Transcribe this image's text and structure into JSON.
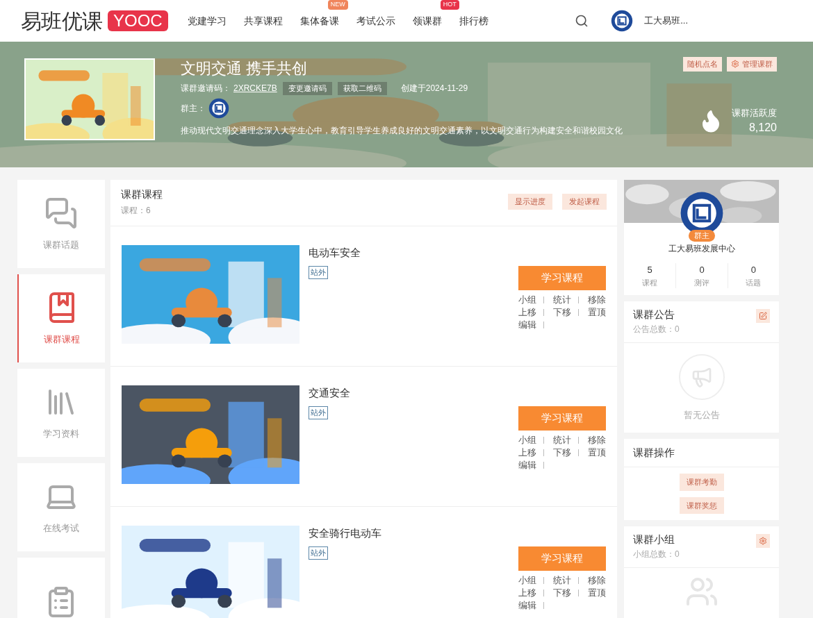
{
  "header": {
    "logo_text": "易班优课",
    "logo_badge": "YOOC",
    "nav": [
      {
        "label": "党建学习"
      },
      {
        "label": "共享课程"
      },
      {
        "label": "集体备课",
        "badge": "NEW"
      },
      {
        "label": "考试公示"
      },
      {
        "label": "领课群",
        "badge": "HOT"
      },
      {
        "label": "排行榜"
      }
    ],
    "user": "工大易班..."
  },
  "banner": {
    "title": "文明交通 携手共创",
    "invite_label": "课群邀请码：",
    "invite_code": "2XRCKE7B",
    "buttons": [
      "变更邀请码",
      "获取二维码"
    ],
    "created": "创建于2024-11-29",
    "owner_label": "群主：",
    "description": "推动现代文明交通理念深入大学生心中，教育引导学生养成良好的文明交通素养，以文明交通行为构建安全和谐校园文化",
    "actions": [
      {
        "label": "随机点名",
        "kind": "plain"
      },
      {
        "label": "管理课群",
        "kind": "gear"
      }
    ],
    "activity_label": "课群活跃度",
    "activity_value": "8,120"
  },
  "sidebar": {
    "items": [
      {
        "label": "课群话题",
        "selected": false
      },
      {
        "label": "课群课程",
        "selected": true
      },
      {
        "label": "学习资料",
        "selected": false
      },
      {
        "label": "在线考试",
        "selected": false
      },
      {
        "selected": false
      }
    ]
  },
  "courses": {
    "title": "课群课程",
    "count": "课程：6",
    "buttons": [
      "显示进度",
      "发起课程"
    ],
    "items": [
      {
        "title": "电动车安全",
        "tag": "站外",
        "study": "学习课程",
        "actions": [
          [
            "小组",
            "统计",
            "移除"
          ],
          [
            "上移",
            "下移",
            "置顶"
          ],
          [
            "编辑"
          ]
        ]
      },
      {
        "title": "交通安全",
        "tag": "站外",
        "study": "学习课程",
        "actions": [
          [
            "小组",
            "统计",
            "移除"
          ],
          [
            "上移",
            "下移",
            "置顶"
          ],
          [
            "编辑"
          ]
        ]
      },
      {
        "title": "安全骑行电动车",
        "tag": "站外",
        "study": "学习课程",
        "actions": [
          [
            "小组",
            "统计",
            "移除"
          ],
          [
            "上移",
            "下移",
            "置顶"
          ],
          [
            "编辑"
          ]
        ]
      }
    ]
  },
  "owner_card": {
    "role": "群主",
    "name": "工大易班发展中心",
    "stats": [
      {
        "value": "5",
        "label": "课程"
      },
      {
        "value": "0",
        "label": "测评"
      },
      {
        "value": "0",
        "label": "话题"
      }
    ]
  },
  "notice": {
    "title": "课群公告",
    "count": "公告总数：0",
    "empty": "暂无公告"
  },
  "operations": {
    "title": "课群操作",
    "buttons": [
      "课群考勤",
      "课群奖惩"
    ]
  },
  "groups": {
    "title": "课群小组",
    "count": "小组总数：0"
  }
}
